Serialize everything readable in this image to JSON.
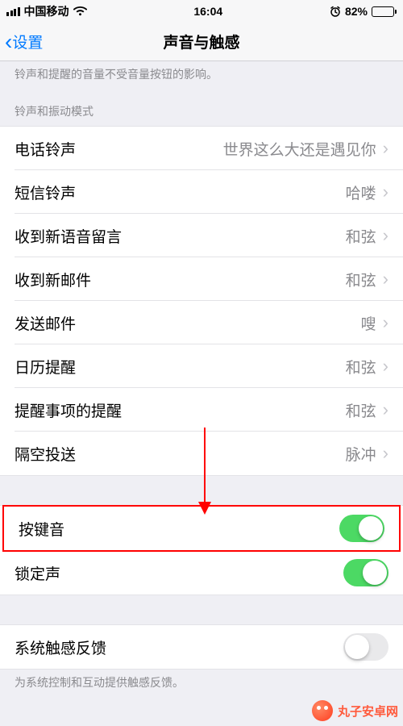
{
  "status": {
    "carrier": "中国移动",
    "time": "16:04",
    "battery_pct": "82%"
  },
  "nav": {
    "back_label": "设置",
    "title": "声音与触感"
  },
  "top_desc": "铃声和提醒的音量不受音量按钮的影响。",
  "section_header_1": "铃声和振动模式",
  "sounds": [
    {
      "label": "电话铃声",
      "value": "世界这么大还是遇见你"
    },
    {
      "label": "短信铃声",
      "value": "哈喽"
    },
    {
      "label": "收到新语音留言",
      "value": "和弦"
    },
    {
      "label": "收到新邮件",
      "value": "和弦"
    },
    {
      "label": "发送邮件",
      "value": "嗖"
    },
    {
      "label": "日历提醒",
      "value": "和弦"
    },
    {
      "label": "提醒事项的提醒",
      "value": "和弦"
    },
    {
      "label": "隔空投送",
      "value": "脉冲"
    }
  ],
  "toggles": {
    "keyboard_clicks": {
      "label": "按键音",
      "on": true
    },
    "lock_sound": {
      "label": "锁定声",
      "on": true
    }
  },
  "haptic": {
    "label": "系统触感反馈",
    "on": false,
    "footer": "为系统控制和互动提供触感反馈。"
  },
  "watermark": "丸子安卓网"
}
